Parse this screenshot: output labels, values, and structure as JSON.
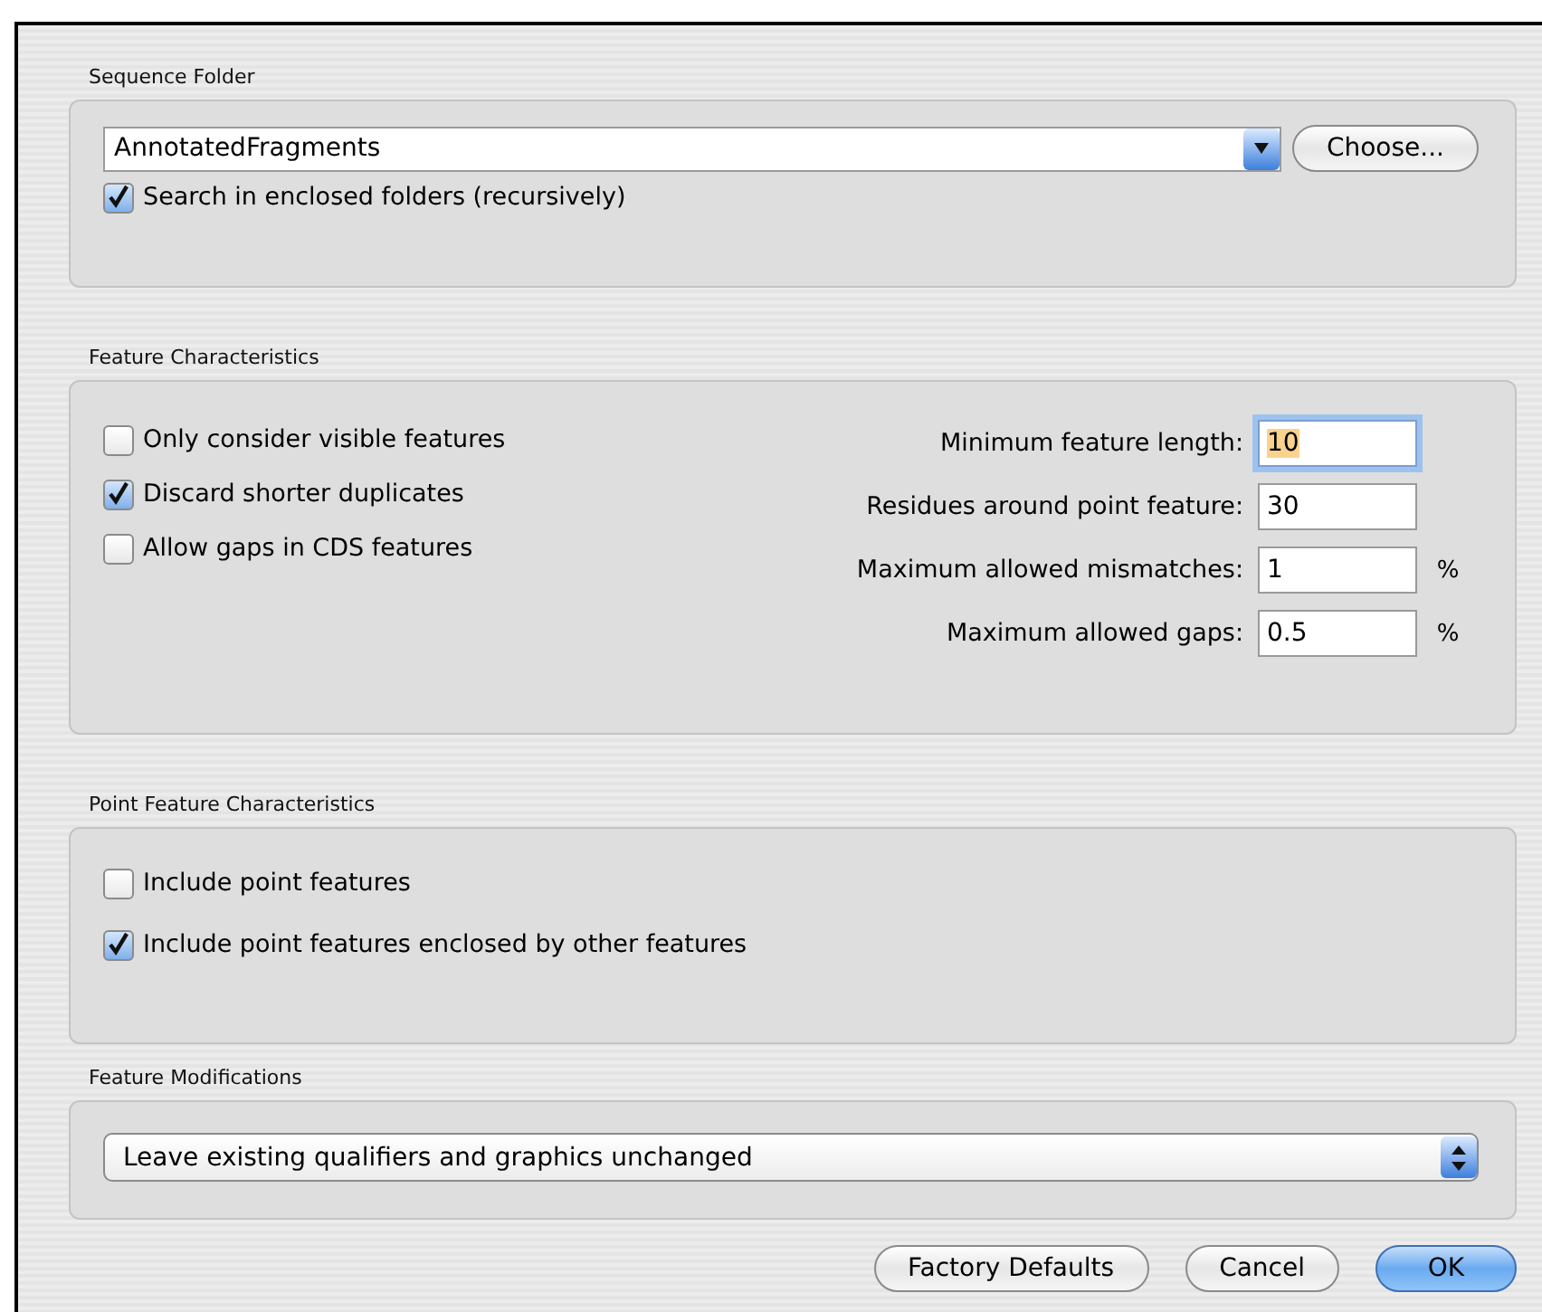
{
  "sequence_folder": {
    "title": "Sequence Folder",
    "folder": "AnnotatedFragments",
    "choose_button": "Choose...",
    "recursive": {
      "label": "Search in enclosed folders (recursively)",
      "checked": true
    }
  },
  "feature_characteristics": {
    "title": "Feature Characteristics",
    "options": [
      {
        "label": "Only consider visible features",
        "checked": false
      },
      {
        "label": "Discard shorter duplicates",
        "checked": true
      },
      {
        "label": "Allow gaps in CDS features",
        "checked": false
      }
    ],
    "fields": [
      {
        "label": "Minimum feature length:",
        "value": "10",
        "focused": true
      },
      {
        "label": "Residues around point feature:",
        "value": "30",
        "focused": false
      },
      {
        "label": "Maximum allowed mismatches:",
        "value": "1",
        "focused": false,
        "unit": "%"
      },
      {
        "label": "Maximum allowed gaps:",
        "value": "0.5",
        "focused": false,
        "unit": "%"
      }
    ]
  },
  "point_feature_characteristics": {
    "title": "Point Feature Characteristics",
    "options": [
      {
        "label": "Include point features",
        "checked": false
      },
      {
        "label": "Include point features enclosed by other features",
        "checked": true
      }
    ]
  },
  "feature_modifications": {
    "title": "Feature Modifications",
    "selection": "Leave existing qualifiers and graphics unchanged"
  },
  "buttons": [
    {
      "label": "Factory Defaults",
      "kind": "normal"
    },
    {
      "label": "Cancel",
      "kind": "normal"
    },
    {
      "label": "OK",
      "kind": "default"
    }
  ]
}
